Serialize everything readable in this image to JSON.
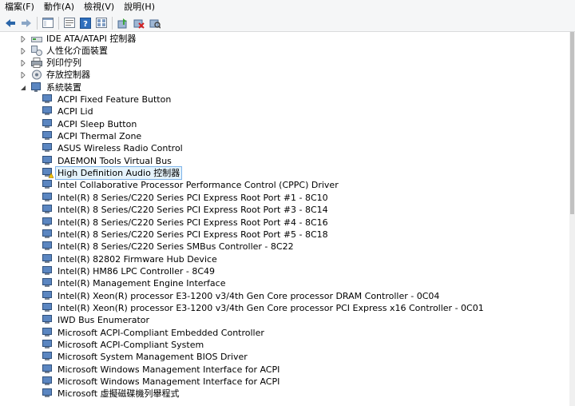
{
  "menubar": {
    "items": [
      {
        "label": "檔案(F)"
      },
      {
        "label": "動作(A)"
      },
      {
        "label": "檢視(V)"
      },
      {
        "label": "說明(H)"
      }
    ]
  },
  "toolbar": {
    "icons": [
      "back-icon",
      "forward-icon",
      "show-hide-console-tree-icon",
      "properties-icon",
      "help-icon",
      "view-icon",
      "update-driver-icon",
      "uninstall-device-icon",
      "scan-hardware-icon"
    ]
  },
  "tree": {
    "categories": [
      {
        "label": "IDE ATA/ATAPI 控制器",
        "expanded": false
      },
      {
        "label": "人性化介面裝置",
        "expanded": false
      },
      {
        "label": "列印佇列",
        "expanded": false
      },
      {
        "label": "存放控制器",
        "expanded": false
      },
      {
        "label": "系統裝置",
        "expanded": true
      }
    ],
    "system_devices": [
      {
        "label": "ACPI Fixed Feature Button"
      },
      {
        "label": "ACPI Lid"
      },
      {
        "label": "ACPI Sleep Button"
      },
      {
        "label": "ACPI Thermal Zone"
      },
      {
        "label": "ASUS Wireless Radio Control"
      },
      {
        "label": "DAEMON Tools Virtual Bus"
      },
      {
        "label": "High Definition Audio 控制器",
        "selected": true,
        "warning": true
      },
      {
        "label": "Intel Collaborative Processor Performance Control (CPPC) Driver"
      },
      {
        "label": "Intel(R) 8 Series/C220 Series PCI Express Root Port #1 - 8C10"
      },
      {
        "label": "Intel(R) 8 Series/C220 Series PCI Express Root Port #3 - 8C14"
      },
      {
        "label": "Intel(R) 8 Series/C220 Series PCI Express Root Port #4 - 8C16"
      },
      {
        "label": "Intel(R) 8 Series/C220 Series PCI Express Root Port #5 - 8C18"
      },
      {
        "label": "Intel(R) 8 Series/C220 Series SMBus Controller - 8C22"
      },
      {
        "label": "Intel(R) 82802 Firmware Hub Device"
      },
      {
        "label": "Intel(R) HM86 LPC Controller - 8C49"
      },
      {
        "label": "Intel(R) Management Engine Interface"
      },
      {
        "label": "Intel(R) Xeon(R) processor E3-1200 v3/4th Gen Core processor DRAM Controller - 0C04"
      },
      {
        "label": "Intel(R) Xeon(R) processor E3-1200 v3/4th Gen Core processor PCI Express x16 Controller - 0C01"
      },
      {
        "label": "IWD Bus Enumerator"
      },
      {
        "label": "Microsoft ACPI-Compliant Embedded Controller"
      },
      {
        "label": "Microsoft ACPI-Compliant System"
      },
      {
        "label": "Microsoft System Management BIOS Driver"
      },
      {
        "label": "Microsoft Windows Management Interface for ACPI"
      },
      {
        "label": "Microsoft Windows Management Interface for ACPI"
      },
      {
        "label": "Microsoft 虛擬磁碟機列舉程式"
      }
    ]
  },
  "colors": {
    "selection_bg": "#e5f3fb",
    "selection_border": "#7eb4ea",
    "warning": "#f5c400"
  }
}
